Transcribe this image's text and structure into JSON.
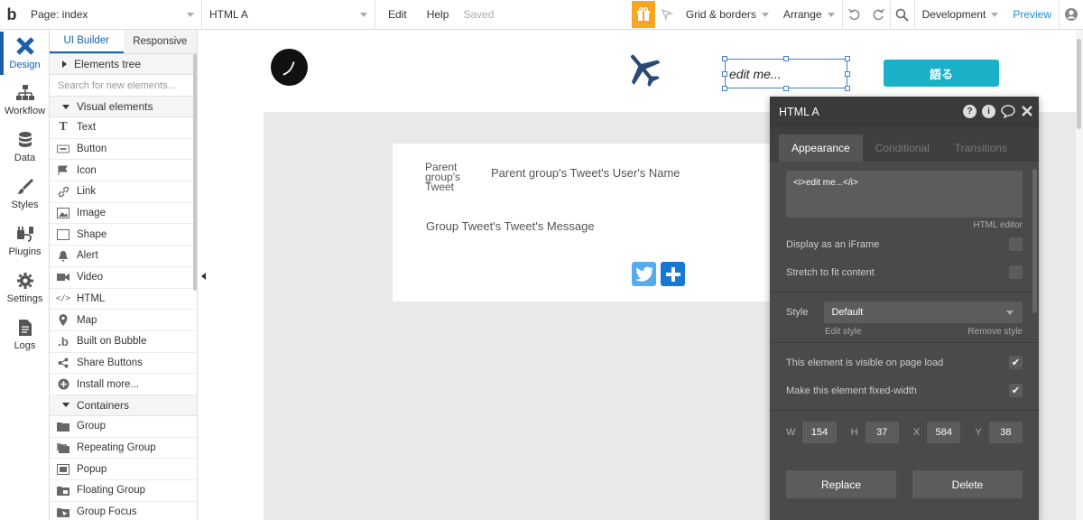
{
  "topbar": {
    "logo": "b",
    "page_select": "Page: index",
    "element_select": "HTML A",
    "menu_edit": "Edit",
    "menu_help": "Help",
    "status": "Saved",
    "grid_borders": "Grid & borders",
    "arrange": "Arrange",
    "env": "Development",
    "preview": "Preview"
  },
  "leftnav": {
    "items": [
      {
        "label": "Design"
      },
      {
        "label": "Workflow"
      },
      {
        "label": "Data"
      },
      {
        "label": "Styles"
      },
      {
        "label": "Plugins"
      },
      {
        "label": "Settings"
      },
      {
        "label": "Logs"
      }
    ]
  },
  "panel": {
    "tab_ui_builder": "UI Builder",
    "tab_responsive": "Responsive",
    "elements_tree": "Elements tree",
    "search_placeholder": "Search for new elements...",
    "visual_elements": "Visual elements",
    "visual_items": [
      {
        "label": "Text",
        "icon": "text-icon"
      },
      {
        "label": "Button",
        "icon": "button-icon"
      },
      {
        "label": "Icon",
        "icon": "flag-icon"
      },
      {
        "label": "Link",
        "icon": "link-icon"
      },
      {
        "label": "Image",
        "icon": "image-icon"
      },
      {
        "label": "Shape",
        "icon": "shape-icon"
      },
      {
        "label": "Alert",
        "icon": "bell-icon"
      },
      {
        "label": "Video",
        "icon": "video-icon"
      },
      {
        "label": "HTML",
        "icon": "code-icon"
      },
      {
        "label": "Map",
        "icon": "map-pin-icon"
      },
      {
        "label": "Built on Bubble",
        "icon": "bubble-logo-icon"
      },
      {
        "label": "Share Buttons",
        "icon": "share-icon"
      },
      {
        "label": "Install more...",
        "icon": "plus-circle-icon"
      }
    ],
    "containers": "Containers",
    "container_items": [
      {
        "label": "Group",
        "icon": "folder-icon"
      },
      {
        "label": "Repeating Group",
        "icon": "repeating-group-icon"
      },
      {
        "label": "Popup",
        "icon": "popup-icon"
      },
      {
        "label": "Floating Group",
        "icon": "floating-group-icon"
      },
      {
        "label": "Group Focus",
        "icon": "group-focus-icon"
      }
    ]
  },
  "canvas": {
    "logo_glyph": "ノ",
    "html_element_text": "edit me...",
    "cta_label": "語る",
    "avatar_text": "Parent group's Tweet",
    "username": "Parent group's Tweet's User's Name",
    "message": "Group Tweet's Tweet's Message"
  },
  "property_editor": {
    "title": "HTML A",
    "tabs": [
      "Appearance",
      "Conditional",
      "Transitions"
    ],
    "code": "<i>edit me...</i>",
    "html_editor_link": "HTML editor",
    "display_iframe": "Display as an iFrame",
    "stretch": "Stretch to fit content",
    "style_label": "Style",
    "style_value": "Default",
    "edit_style": "Edit style",
    "remove_style": "Remove style",
    "visible_on_load": "This element is visible on page load",
    "fixed_width": "Make this element fixed-width",
    "w_label": "W",
    "w_value": "154",
    "h_label": "H",
    "h_value": "37",
    "x_label": "X",
    "x_value": "584",
    "y_label": "Y",
    "y_value": "38",
    "replace": "Replace",
    "delete": "Delete"
  },
  "colors": {
    "accent": "#1b5fa8",
    "cta": "#19b0c8",
    "gift": "#f5a623",
    "twitter": "#55acee",
    "share_plus": "#1877d2",
    "editor_bg": "#4a4a4a"
  }
}
